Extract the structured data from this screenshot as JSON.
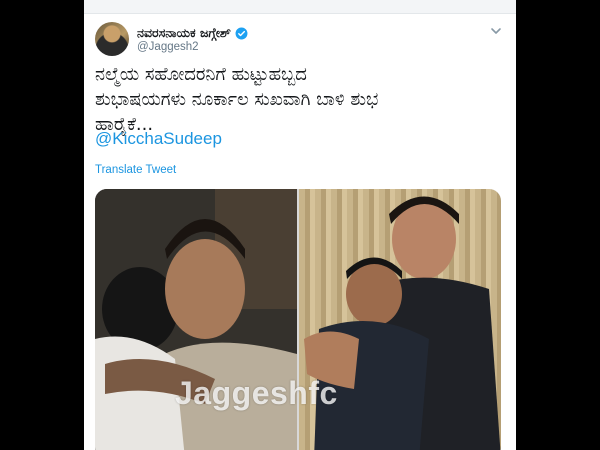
{
  "tweet": {
    "display_name": "ನವರಸನಾಯಕ ಜಗ್ಗೇಶ್",
    "handle": "@Jaggesh2",
    "text_lines": [
      "ನಲ್ಮೆಯ ಸಹೋದರನಿಗೆ ಹುಟ್ಟುಹಬ್ಬದ",
      "ಶುಭಾಷಯಗಳು ನೂರ್ಕಾಲ ಸುಖವಾಗಿ ಬಾಳಿ ಶುಭ",
      "ಹಾರೈಕೆ..."
    ],
    "mention": "@KicchaSudeep",
    "translate_label": "Translate Tweet",
    "watermark": "Jaggeshfc"
  },
  "icons": {
    "verified": "verified-badge-icon",
    "caret": "chevron-down-icon"
  },
  "colors": {
    "link": "#1b95e0",
    "text": "#14171a",
    "muted": "#657786",
    "verified": "#1da1f2",
    "frame": "#000000"
  }
}
